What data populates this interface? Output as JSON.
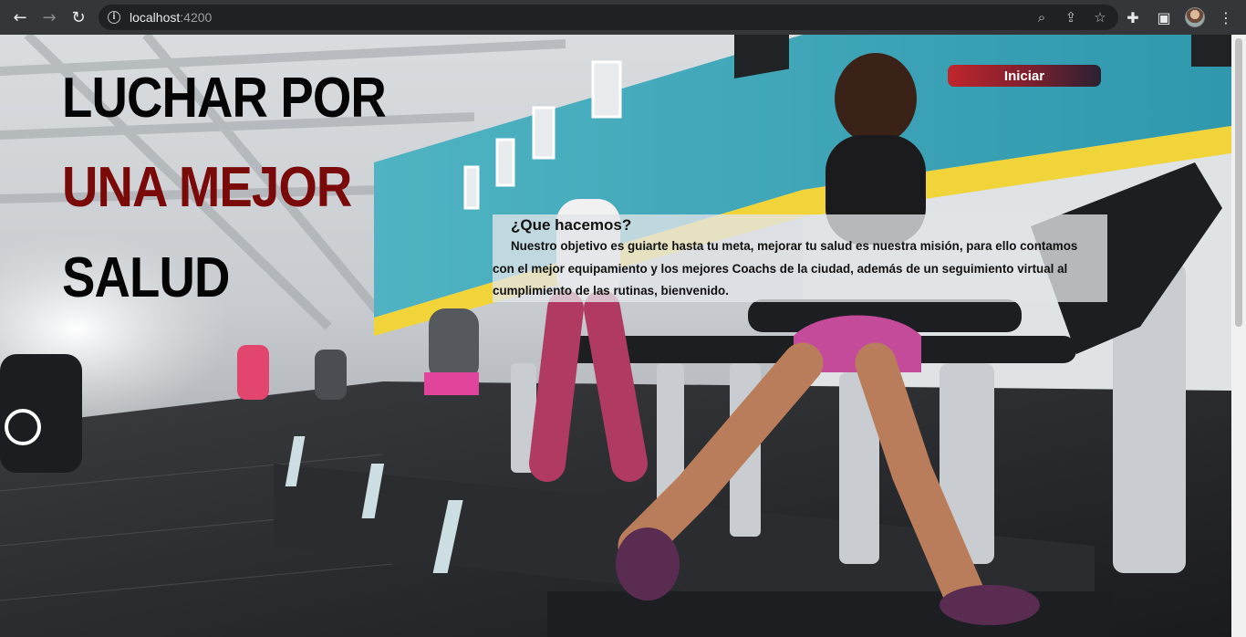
{
  "browser": {
    "url_host": "localhost",
    "url_port": ":4200"
  },
  "hero": {
    "line1": "LUCHAR POR",
    "line2": "UNA MEJOR",
    "line3": "SALUD",
    "start_button": "Iniciar"
  },
  "about": {
    "title": "¿Que hacemos?",
    "text": "Nuestro objetivo es guiarte hasta tu meta, mejorar tu salud es nuestra misión, para ello contamos con el mejor equipamiento y los mejores Coachs de la ciudad, además de un seguimiento virtual al cumplimiento de las rutinas, bienvenido."
  },
  "colors": {
    "accent_red": "#7a0a0a",
    "button_start": "#c0262d",
    "button_end": "#2a2132"
  }
}
